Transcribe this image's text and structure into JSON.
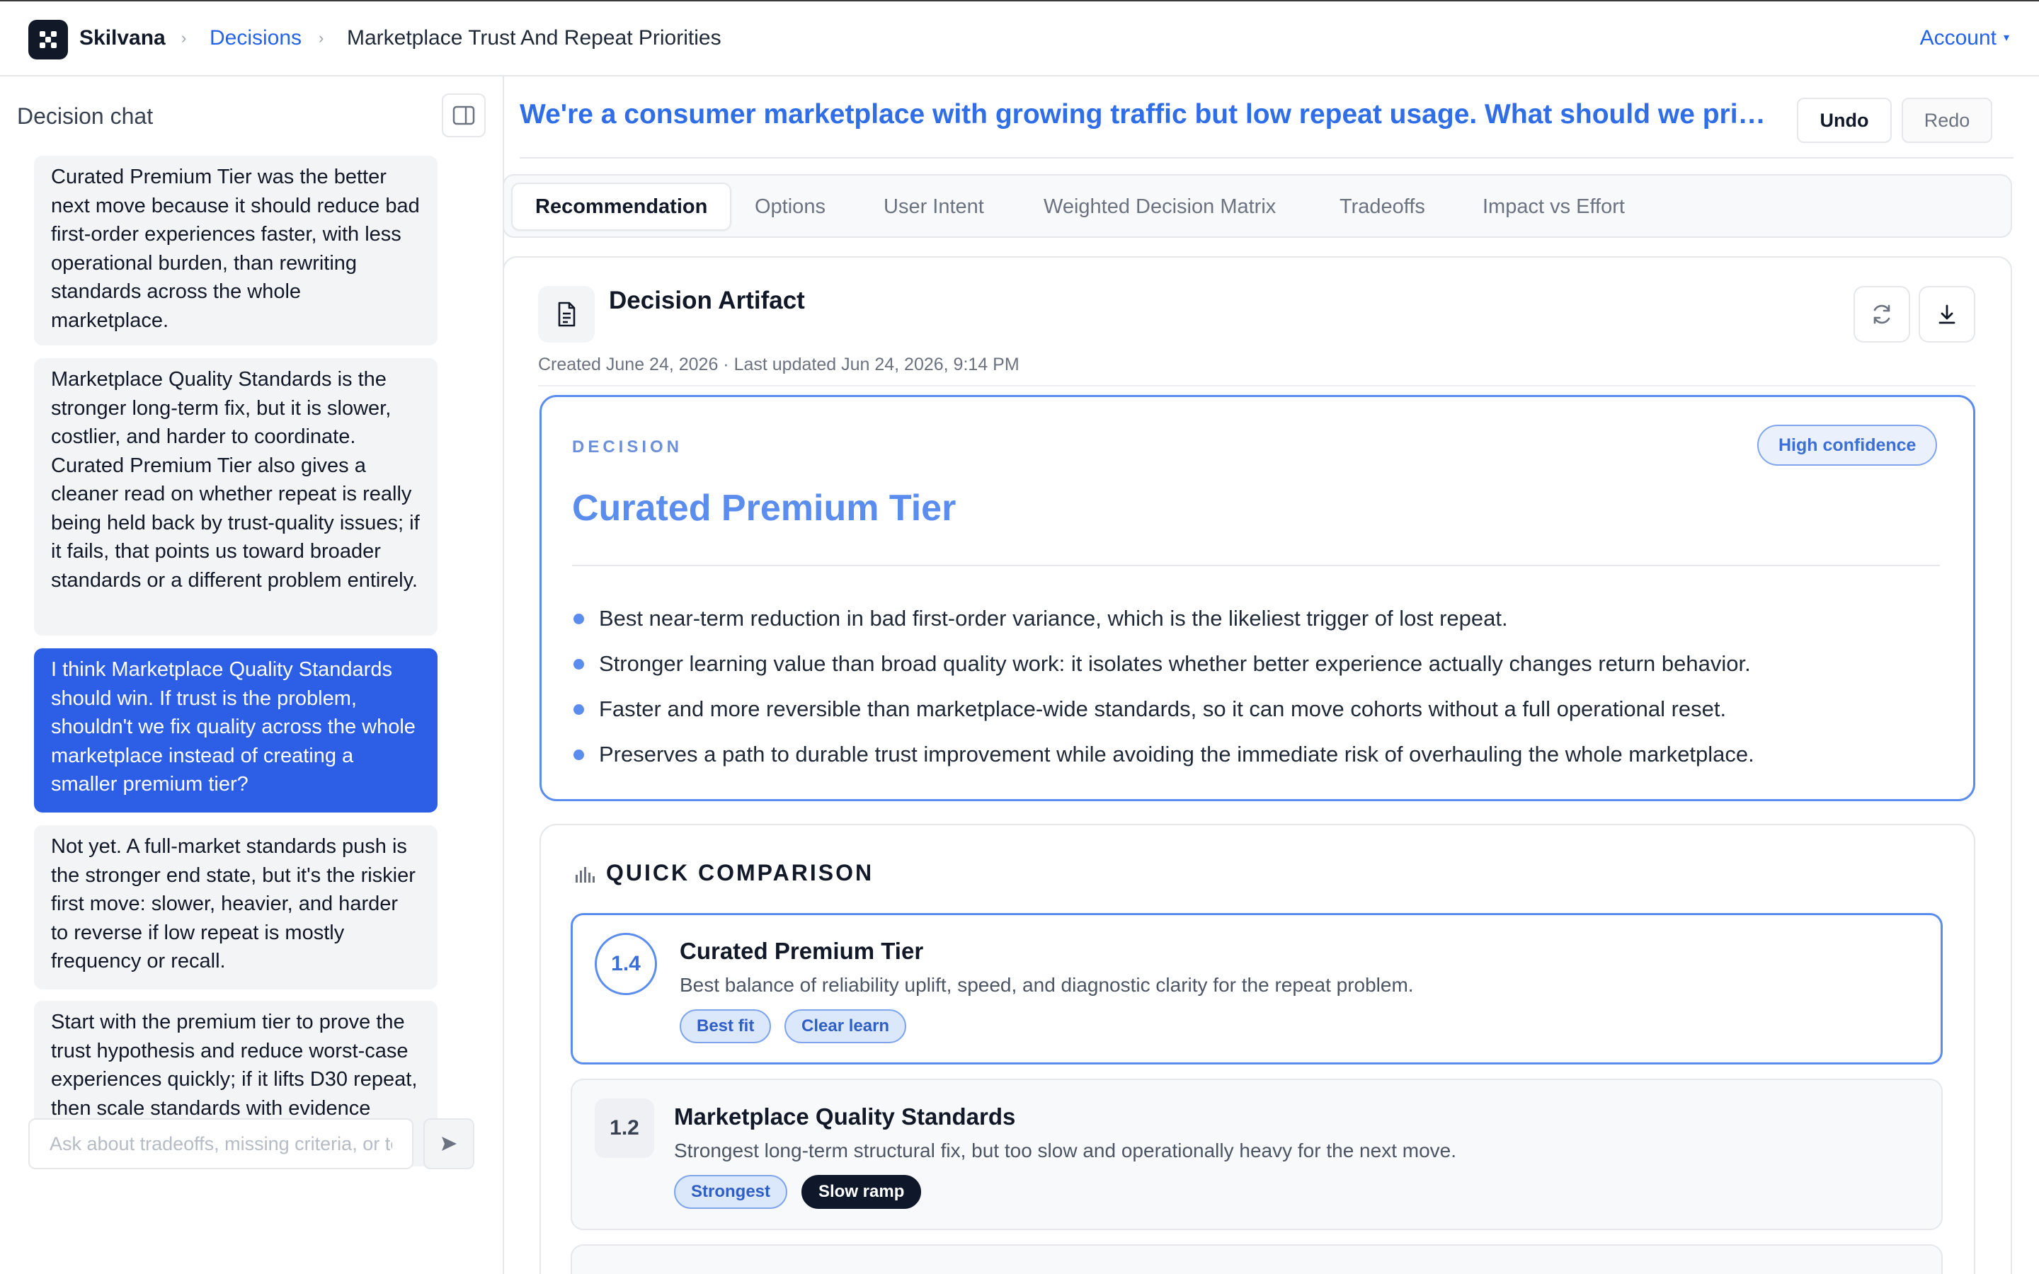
{
  "app": {
    "brand": "Skilvana",
    "breadcrumb": {
      "section": "Decisions",
      "current": "Marketplace Trust And Repeat Priorities"
    },
    "account_label": "Account"
  },
  "sidebar": {
    "title": "Decision chat",
    "messages": [
      {
        "role": "assistant",
        "text": "Curated Premium Tier was the better next move because it should reduce bad first-order experiences faster, with less operational burden, than rewriting standards across the whole marketplace."
      },
      {
        "role": "assistant",
        "text": "Marketplace Quality Standards is the stronger long-term fix, but it is slower, costlier, and harder to coordinate. Curated Premium Tier also gives a cleaner read on whether repeat is really being held back by trust-quality issues; if it fails, that points us toward broader standards or a different problem entirely."
      },
      {
        "role": "user",
        "text": "I think Marketplace Quality Standards should win. If trust is the problem, shouldn't we fix quality across the whole marketplace instead of creating a smaller premium tier?"
      },
      {
        "role": "assistant",
        "text": "Not yet. A full-market standards push is the stronger end state, but it's the riskier first move: slower, heavier, and harder to reverse if low repeat is mostly frequency or recall."
      },
      {
        "role": "assistant",
        "text": "Start with the premium tier to prove the trust hypothesis and reduce worst-case experiences quickly; if it lifts D30 repeat, then scale standards with evidence instead of assumption."
      }
    ],
    "input_placeholder": "Ask about tradeoffs, missing criteria, or tests...",
    "input_value": ""
  },
  "main": {
    "question": "We're a consumer marketplace with growing traffic but low repeat usage. What should we prioritize next?",
    "undo_label": "Undo",
    "redo_label": "Redo",
    "tabs": [
      {
        "label": "Recommendation",
        "active": true
      },
      {
        "label": "Options",
        "active": false
      },
      {
        "label": "User Intent",
        "active": false
      },
      {
        "label": "Weighted Decision Matrix",
        "active": false
      },
      {
        "label": "Tradeoffs",
        "active": false
      },
      {
        "label": "Impact vs Effort",
        "active": false
      }
    ]
  },
  "artifact": {
    "title": "Decision Artifact",
    "meta": "Created June 24, 2026 · Last updated Jun 24, 2026, 9:14 PM",
    "decision": {
      "label": "DECISION",
      "confidence": "High confidence",
      "title": "Curated Premium Tier",
      "bullets": [
        "Best near-term reduction in bad first-order variance, which is the likeliest trigger of lost repeat.",
        "Stronger learning value than broad quality work: it isolates whether better experience actually changes return behavior.",
        "Faster and more reversible than marketplace-wide standards, so it can move cohorts without a full operational reset.",
        "Preserves a path to durable trust improvement while avoiding the immediate risk of overhauling the whole marketplace."
      ]
    },
    "comparison": {
      "title": "QUICK COMPARISON",
      "options": [
        {
          "score": "1.4",
          "title": "Curated Premium Tier",
          "description": "Best balance of reliability uplift, speed, and diagnostic clarity for the repeat problem.",
          "chips": [
            "Best fit",
            "Clear learn"
          ]
        },
        {
          "score": "1.2",
          "title": "Marketplace Quality Standards",
          "description": "Strongest long-term structural fix, but too slow and operationally heavy for the next move.",
          "chips": [
            "Strongest",
            "Slow ramp"
          ]
        }
      ]
    }
  },
  "colors": {
    "accent": "#2563eb",
    "decision_blue": "#5b8def",
    "user_bubble": "#2d5ee6",
    "dark_chip": "#0f172a"
  },
  "icons": {
    "logo": "skilvana-logo-icon",
    "collapse": "sidebar-toggle-icon",
    "send": "send-arrow-icon",
    "document": "document-icon",
    "refresh": "refresh-icon",
    "download": "download-icon",
    "comparison": "bar-chart-icon"
  }
}
